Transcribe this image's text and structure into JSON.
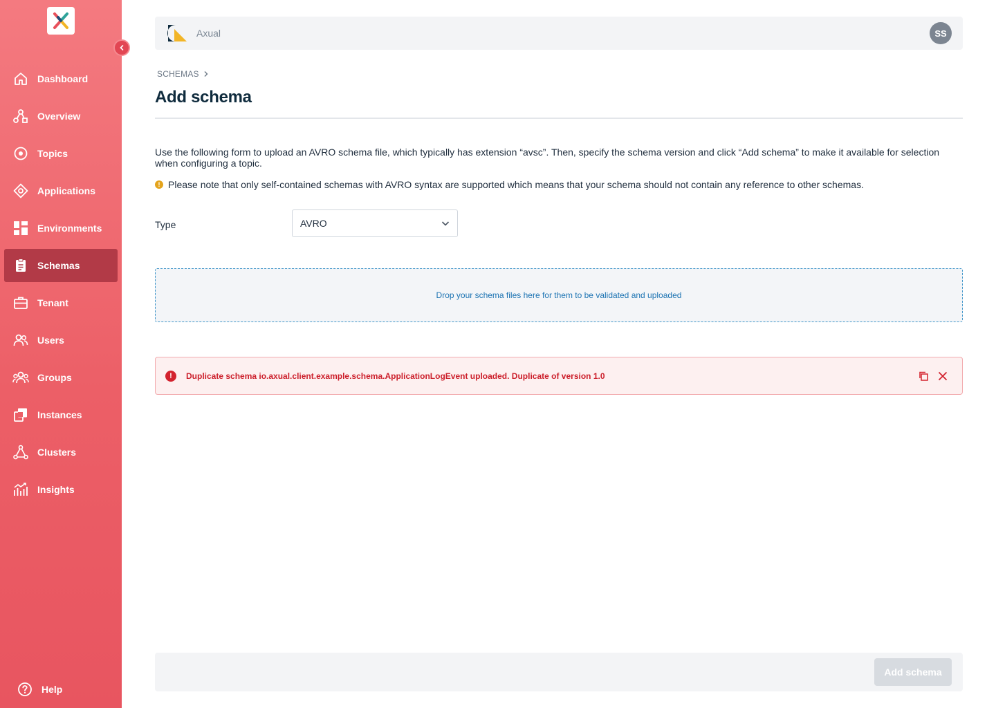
{
  "sidebar": {
    "items": [
      {
        "label": "Dashboard",
        "icon": "home-icon"
      },
      {
        "label": "Overview",
        "icon": "overview-icon"
      },
      {
        "label": "Topics",
        "icon": "topic-icon"
      },
      {
        "label": "Applications",
        "icon": "application-icon"
      },
      {
        "label": "Environments",
        "icon": "grid-icon"
      },
      {
        "label": "Schemas",
        "icon": "clipboard-icon",
        "active": true
      },
      {
        "label": "Tenant",
        "icon": "briefcase-icon"
      },
      {
        "label": "Users",
        "icon": "users-icon"
      },
      {
        "label": "Groups",
        "icon": "groups-icon"
      },
      {
        "label": "Instances",
        "icon": "instances-icon"
      },
      {
        "label": "Clusters",
        "icon": "cluster-icon"
      },
      {
        "label": "Insights",
        "icon": "insights-icon"
      }
    ],
    "help_label": "Help"
  },
  "topbar": {
    "org_name": "Axual",
    "avatar_initials": "SS"
  },
  "breadcrumb": {
    "root": "SCHEMAS"
  },
  "page": {
    "title": "Add schema",
    "description": "Use the following form to upload an AVRO schema file, which typically has extension “avsc”. Then, specify the schema version and click “Add schema” to make it available for selection when configuring a topic.",
    "note": "Please note that only self-contained schemas with AVRO syntax are supported which means that your schema should not contain any reference to other schemas."
  },
  "form": {
    "type_label": "Type",
    "type_value": "AVRO",
    "dropzone_text": "Drop your schema files here for them to be validated and uploaded"
  },
  "alert": {
    "message": "Duplicate schema io.axual.client.example.schema.ApplicationLogEvent uploaded. Duplicate of version 1.0"
  },
  "footer": {
    "add_button_label": "Add schema"
  },
  "colors": {
    "sidebar_top": "#f47a80",
    "sidebar_bottom": "#e85560",
    "active_item": "#b23a47",
    "error": "#cc1f2b",
    "link": "#1d74b3"
  }
}
